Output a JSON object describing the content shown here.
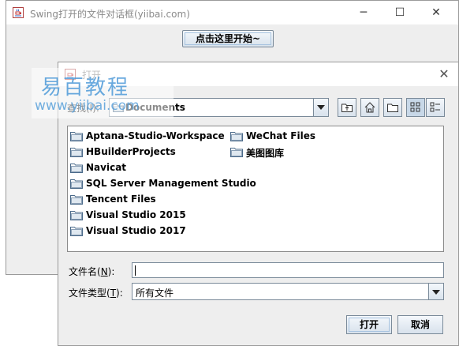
{
  "main_window": {
    "title": "Swing打开的文件对话框(yiibai.com)",
    "minimize": "─",
    "maximize": "☐",
    "close": "✕",
    "start_button": "点击这里开始~"
  },
  "dialog": {
    "title": "打开",
    "close": "✕",
    "look_in_label": "查找(I):",
    "look_in_value": "Documents",
    "toolbar": [
      {
        "name": "up-one-level-icon"
      },
      {
        "name": "home-icon"
      },
      {
        "name": "new-folder-icon"
      },
      {
        "name": "list-view-icon"
      },
      {
        "name": "details-view-icon"
      }
    ],
    "files_col1": [
      "Aptana-Studio-Workspace",
      "HBuilderProjects",
      "Navicat",
      "SQL Server Management Studio",
      "Tencent Files",
      "Visual Studio 2015",
      "Visual Studio 2017"
    ],
    "files_col2": [
      "WeChat Files",
      "美图图库"
    ],
    "file_name_label": "文件名(N):",
    "file_name_value": "",
    "file_type_label": "文件类型(T):",
    "file_type_value": "所有文件",
    "open_button": "打开",
    "cancel_button": "取消"
  },
  "watermark": {
    "line1": "易百教程",
    "line2": "www.yiibai.com"
  },
  "colors": {
    "window_bg": "#eeeeee",
    "button_border": "#7a8a99",
    "watermark": "#4f9bd9"
  }
}
